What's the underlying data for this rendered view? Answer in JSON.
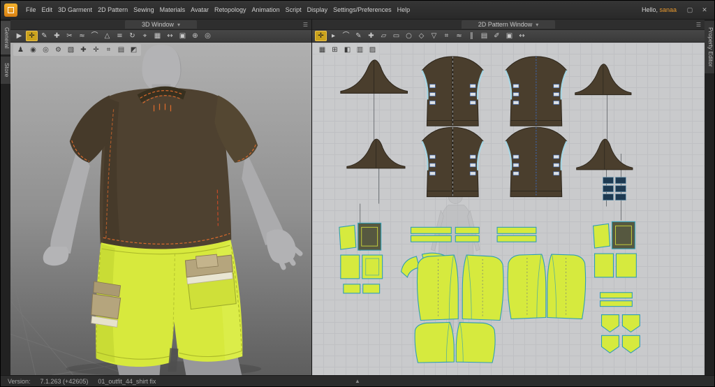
{
  "app": {
    "greeting_prefix": "Hello, ",
    "username": "sanaa",
    "window_controls": [
      {
        "name": "restore-window-icon",
        "glyph": "▢"
      },
      {
        "name": "close-window-icon",
        "glyph": "✕"
      }
    ]
  },
  "menubar": {
    "items": [
      "File",
      "Edit",
      "3D Garment",
      "2D Pattern",
      "Sewing",
      "Materials",
      "Avatar",
      "Retopology",
      "Animation",
      "Script",
      "Display",
      "Settings/Preferences",
      "Help"
    ]
  },
  "side_tabs": {
    "left": [
      {
        "name": "tab-general",
        "label": "General"
      },
      {
        "name": "tab-store",
        "label": "Store"
      }
    ],
    "right": [
      {
        "name": "tab-property-editor",
        "label": "Property Editor"
      }
    ]
  },
  "panes": {
    "view3d": {
      "title": "3D Window",
      "chevron": "▾",
      "menu_glyph": "☰"
    },
    "view2d": {
      "title": "2D Pattern Window",
      "chevron": "▾",
      "menu_glyph": "☰"
    }
  },
  "toolbars": {
    "view3d_main": [
      {
        "name": "simulate-tool",
        "glyph": "▶"
      },
      {
        "name": "select-move-tool",
        "glyph": "✛",
        "active": true
      },
      {
        "name": "select-mesh-brush-tool",
        "glyph": "✎"
      },
      {
        "name": "pin-tool",
        "glyph": "✚"
      },
      {
        "name": "sewing-edit-tool",
        "glyph": "✂"
      },
      {
        "name": "segment-sewing-tool",
        "glyph": "≈"
      },
      {
        "name": "free-sewing-tool",
        "glyph": "⌒"
      },
      {
        "name": "fold-arrangement-tool",
        "glyph": "△"
      },
      {
        "name": "wind-controller-tool",
        "glyph": "≡"
      },
      {
        "name": "gizmo-rotate-tool",
        "glyph": "↻"
      },
      {
        "name": "tape-tool",
        "glyph": "⌖"
      },
      {
        "name": "flatten-tool",
        "glyph": "▦"
      },
      {
        "name": "measure-tool",
        "glyph": "↔"
      },
      {
        "name": "texture-tool",
        "glyph": "▣"
      },
      {
        "name": "pattern-3d-pen-tool",
        "glyph": "⊕"
      },
      {
        "name": "zoom-fit-tool",
        "glyph": "◎"
      }
    ],
    "view3d_avatar": [
      {
        "name": "show-avatar-icon",
        "glyph": "♟"
      },
      {
        "name": "show-arrangement-points-icon",
        "glyph": "◉"
      },
      {
        "name": "show-arrangement-volumes-icon",
        "glyph": "◎"
      },
      {
        "name": "avatar-skin-offset-icon",
        "glyph": "⚙"
      },
      {
        "name": "show-garment-icon",
        "glyph": "▧"
      },
      {
        "name": "show-pins-icon",
        "glyph": "✚"
      },
      {
        "name": "show-gizmo-icon",
        "glyph": "✛"
      },
      {
        "name": "show-grid-icon",
        "glyph": "⌗"
      },
      {
        "name": "show-wireframe-icon",
        "glyph": "▤"
      },
      {
        "name": "show-strain-map-icon",
        "glyph": "◩"
      }
    ],
    "view2d_main": [
      {
        "name": "transform-pattern-tool",
        "glyph": "✛",
        "active": true
      },
      {
        "name": "edit-pattern-tool",
        "glyph": "▸"
      },
      {
        "name": "edit-curvature-tool",
        "glyph": "⌒"
      },
      {
        "name": "edit-curve-point-tool",
        "glyph": "✎"
      },
      {
        "name": "add-point-split-tool",
        "glyph": "✚"
      },
      {
        "name": "polygon-tool",
        "glyph": "▱"
      },
      {
        "name": "rectangle-tool",
        "glyph": "▭"
      },
      {
        "name": "circle-tool",
        "glyph": "○"
      },
      {
        "name": "dart-tool",
        "glyph": "◇"
      },
      {
        "name": "notch-dart-tool",
        "glyph": "▽"
      },
      {
        "name": "seam-allowance-tool",
        "glyph": "⌗"
      },
      {
        "name": "segment-sewing-2d-tool",
        "glyph": "≈"
      },
      {
        "name": "free-sewing-2d-tool",
        "glyph": "∥"
      },
      {
        "name": "grading-tool",
        "glyph": "▤"
      },
      {
        "name": "pattern-annotation-tool",
        "glyph": "✐"
      },
      {
        "name": "texture-editor-2d-tool",
        "glyph": "▣"
      },
      {
        "name": "measure-2d-tool",
        "glyph": "↔"
      }
    ],
    "view2d_extra": [
      {
        "name": "show-pattern-outline-icon",
        "glyph": "▦"
      },
      {
        "name": "show-sewing-lines-icon",
        "glyph": "⊞"
      },
      {
        "name": "show-notches-icon",
        "glyph": "◧"
      },
      {
        "name": "show-grainline-icon",
        "glyph": "▥"
      },
      {
        "name": "show-base-line-icon",
        "glyph": "▨"
      }
    ]
  },
  "statusbar": {
    "version_label": "Version:",
    "version_value": "7.1.263 (+42605)",
    "filename": "01_outfit_44_shirt fix",
    "expand_icon": "▲"
  },
  "colors": {
    "accent_orange": "#e8992e",
    "tool_active_bg": "#caa21c",
    "shirt_brown": "#4e4130",
    "shirt_brown_dark": "#3c3223",
    "stitch_orange": "#d96a2c",
    "shorts_yellow": "#d7e93d",
    "shorts_yellow_dark": "#aab829",
    "pattern_brown": "#4a3e2d",
    "pattern_yellow": "#d6ea3e",
    "pattern_teal": "#2f9eb4",
    "seam_highlight_blue": "#a9dcec",
    "navy_piece": "#1e3a52",
    "khaki_pocket": "#b3a37c",
    "avatar_gray": "#b2b2b4",
    "viewport2d_bg": "#c9cacc"
  }
}
